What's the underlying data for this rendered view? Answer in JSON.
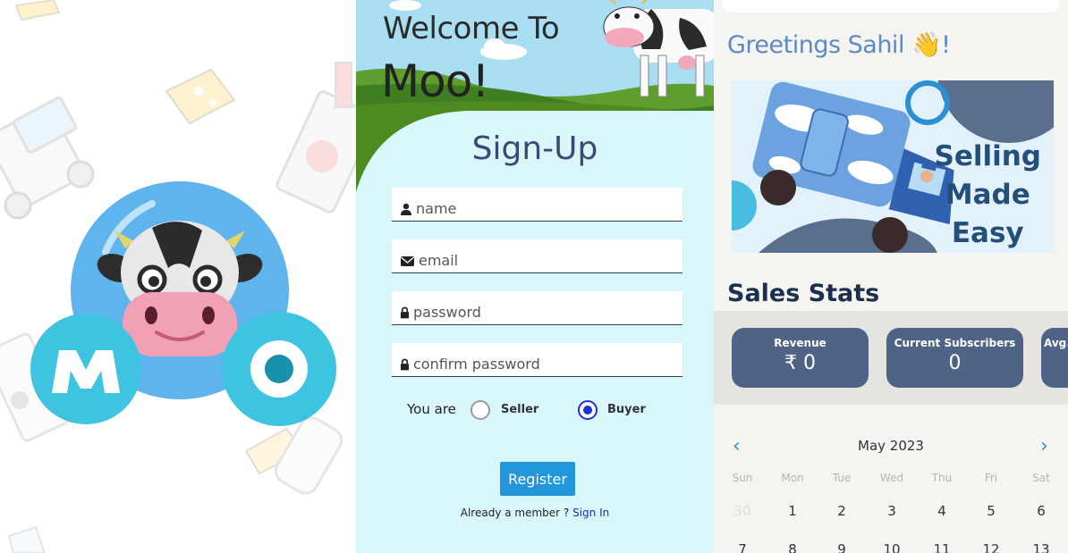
{
  "splash": {
    "logo_letters": [
      "M",
      "O"
    ]
  },
  "signup": {
    "welcome_line1": "Welcome To",
    "welcome_line2": "Moo!",
    "title": "Sign-Up",
    "fields": [
      {
        "placeholder": "name",
        "icon": "user-icon"
      },
      {
        "placeholder": "email",
        "icon": "envelope-icon"
      },
      {
        "placeholder": "password",
        "icon": "lock-icon"
      },
      {
        "placeholder": "confirm password",
        "icon": "lock-icon"
      }
    ],
    "you_are_label": "You are",
    "role_options": [
      "Seller",
      "Buyer"
    ],
    "selected_role": "Buyer",
    "register_label": "Register",
    "already_member": "Already a member ?",
    "sign_in_link": "Sign In",
    "colors": {
      "background": "#d9f6fb",
      "primary_button": "#2196dc",
      "radio_selected": "#1e2fd8"
    }
  },
  "dashboard": {
    "greeting": "Greetings Sahil 👋!",
    "banner_lines": [
      "Selling",
      "Made",
      "Easy"
    ],
    "sales_stats_title": "Sales Stats",
    "stats": [
      {
        "label": "Revenue",
        "value": "₹ 0"
      },
      {
        "label": "Current Subscribers",
        "value": "0"
      },
      {
        "label": "Avg.",
        "value": ""
      }
    ],
    "calendar": {
      "month": "May 2023",
      "prev_icon": "chevron-left-icon",
      "next_icon": "chevron-right-icon",
      "weekdays": [
        "Sun",
        "Mon",
        "Tue",
        "Wed",
        "Thu",
        "Fri",
        "Sat"
      ],
      "week1": [
        "30",
        "1",
        "2",
        "3",
        "4",
        "5",
        "6"
      ],
      "week2": [
        "7",
        "8",
        "9",
        "10",
        "11",
        "12",
        "13"
      ]
    },
    "colors": {
      "greeting": "#5b8ac9",
      "stat_card": "#4e6385",
      "title": "#1d2f4e",
      "nav": "#2c8ee0"
    }
  }
}
